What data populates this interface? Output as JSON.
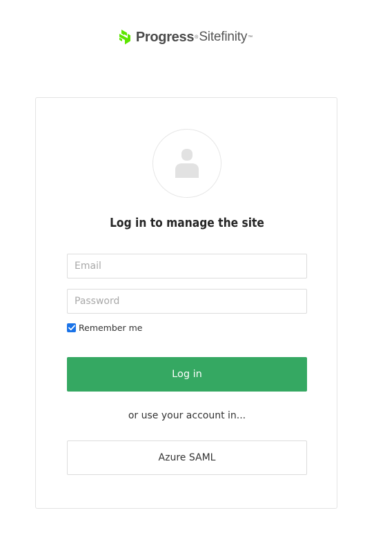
{
  "logo": {
    "brand": "Progress",
    "registered_mark": "®",
    "product": "Sitefinity",
    "trademark": "™",
    "brand_color": "#5ce500"
  },
  "avatar": {
    "icon": "user-icon"
  },
  "login": {
    "title": "Log in to manage the site",
    "email_placeholder": "Email",
    "email_value": "",
    "password_placeholder": "Password",
    "password_value": "",
    "remember_label": "Remember me",
    "remember_checked": true,
    "submit_label": "Log in",
    "alt_text": "or use your account in...",
    "providers": [
      {
        "label": "Azure SAML"
      }
    ]
  },
  "colors": {
    "primary_button": "#35a862",
    "checkbox": "#1a73e8",
    "border": "#dcdcdc"
  }
}
